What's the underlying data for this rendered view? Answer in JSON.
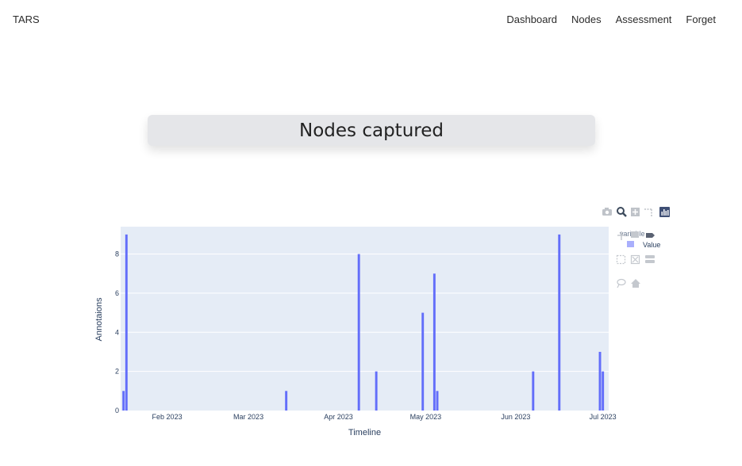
{
  "navbar": {
    "brand": "TARS",
    "links": [
      {
        "label": "Dashboard"
      },
      {
        "label": "Nodes"
      },
      {
        "label": "Assessment"
      },
      {
        "label": "Forget"
      }
    ]
  },
  "title_card": {
    "text": "Nodes captured"
  },
  "modebar": {
    "top_row": [
      "camera-icon",
      "zoom-icon",
      "pan-icon",
      "spike-lines-icon",
      "plotly-logo-icon"
    ],
    "side_icons": [
      "pan-arrows-icon",
      "compare-hover-icon",
      "box-select-icon",
      "autoscale-icon",
      "toggle-hover-icon",
      "lasso-icon",
      "reset-axes-icon"
    ]
  },
  "colors": {
    "bar": "#636efa",
    "plot_bg": "#e5ecf6",
    "axis_text": "#2a3f5f"
  },
  "chart_data": {
    "type": "bar",
    "xlabel": "Timeline",
    "ylabel": "Annotaions",
    "x_ticks": [
      "Feb 2023",
      "Mar 2023",
      "Apr 2023",
      "May 2023",
      "Jun 2023",
      "Jul 2023"
    ],
    "y_ticks": [
      "0",
      "2",
      "4",
      "6",
      "8"
    ],
    "ylim": [
      0,
      9.4
    ],
    "xlim": [
      "2023-01-16",
      "2023-07-03"
    ],
    "grid": true,
    "legend": {
      "title": "variable",
      "position": "top-right",
      "entries": [
        "Value"
      ]
    },
    "series": [
      {
        "name": "Value",
        "points": [
          {
            "x": "2023-01-17",
            "y": 1
          },
          {
            "x": "2023-01-18",
            "y": 9
          },
          {
            "x": "2023-03-14",
            "y": 1
          },
          {
            "x": "2023-04-08",
            "y": 8
          },
          {
            "x": "2023-04-14",
            "y": 2
          },
          {
            "x": "2023-04-30",
            "y": 5
          },
          {
            "x": "2023-05-04",
            "y": 7
          },
          {
            "x": "2023-05-05",
            "y": 1
          },
          {
            "x": "2023-06-07",
            "y": 2
          },
          {
            "x": "2023-06-16",
            "y": 9
          },
          {
            "x": "2023-06-30",
            "y": 3
          },
          {
            "x": "2023-07-01",
            "y": 2
          }
        ]
      }
    ]
  }
}
